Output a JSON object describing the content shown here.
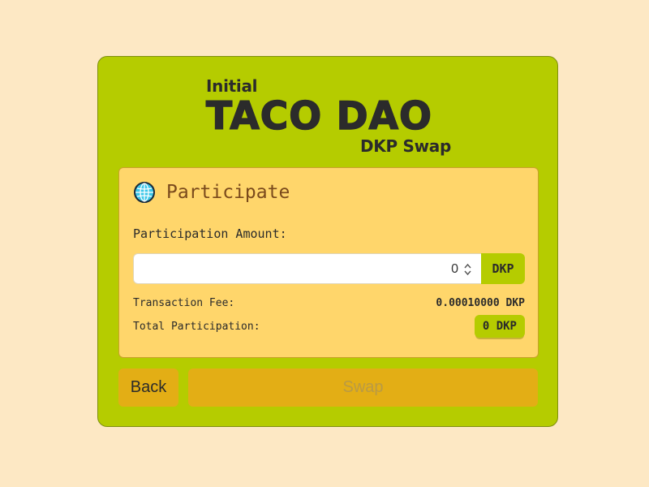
{
  "header": {
    "pre_title": "Initial",
    "title": "TACO DAO",
    "subtitle": "DKP Swap"
  },
  "participate": {
    "icon": "globe-icon",
    "title": "Participate",
    "amount_label": "Participation Amount:",
    "amount_value": "0",
    "unit": "DKP",
    "fee_label": "Transaction Fee:",
    "fee_value": "0.00010000 DKP",
    "total_label": "Total Participation:",
    "total_value": "0 DKP"
  },
  "actions": {
    "back_label": "Back",
    "swap_label": "Swap"
  },
  "colors": {
    "background": "#fde8c4",
    "card": "#b5cc00",
    "panel": "#ffd66b",
    "button": "#e3ae15",
    "text": "#2b2b2b"
  }
}
